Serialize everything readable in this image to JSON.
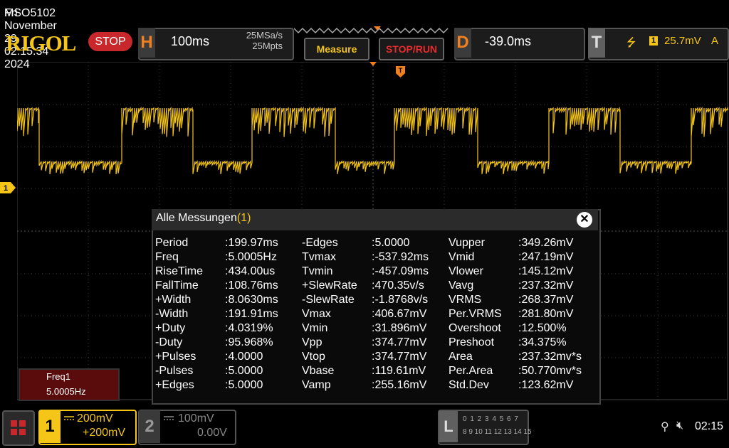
{
  "title_bar": {
    "model": "MSO5102",
    "datetime": "Fri November 29 02:15:34 2024"
  },
  "logo": "RIGOL",
  "status": "STOP",
  "horizontal": {
    "letter": "H",
    "timebase": "100ms",
    "sample_rate": "25MSa/s",
    "memory_depth": "25Mpts"
  },
  "buttons": {
    "measure": "Measure",
    "stop_run": "STOP/RUN"
  },
  "delay": {
    "letter": "D",
    "value": "-39.0ms"
  },
  "trigger": {
    "letter": "T",
    "slope": "⭍",
    "source": "1",
    "level": "25.7mV",
    "mode": "A"
  },
  "channel_marker": "1",
  "measurements": {
    "title": "Alle Messungen",
    "count": "(1)",
    "close": "✕",
    "columns": [
      {
        "rows": [
          {
            "name": "Period",
            "value": ":199.97ms"
          },
          {
            "name": "Freq",
            "value": ":5.0005Hz"
          },
          {
            "name": "RiseTime",
            "value": ":434.00us"
          },
          {
            "name": "FallTime",
            "value": ":108.76ms"
          },
          {
            "name": "+Width",
            "value": ":8.0630ms"
          },
          {
            "name": "-Width",
            "value": ":191.91ms"
          },
          {
            "name": "+Duty",
            "value": ":4.0319%"
          },
          {
            "name": "-Duty",
            "value": ":95.968%"
          },
          {
            "name": "+Pulses",
            "value": ":4.0000"
          },
          {
            "name": "-Pulses",
            "value": ":5.0000"
          },
          {
            "name": "+Edges",
            "value": ":5.0000"
          }
        ]
      },
      {
        "rows": [
          {
            "name": "-Edges",
            "value": ":5.0000"
          },
          {
            "name": "Tvmax",
            "value": ":-537.92ms"
          },
          {
            "name": "Tvmin",
            "value": ":-457.09ms"
          },
          {
            "name": "+SlewRate",
            "value": ":470.35v/s"
          },
          {
            "name": "-SlewRate",
            "value": ":-1.8768v/s"
          },
          {
            "name": "Vmax",
            "value": ":406.67mV"
          },
          {
            "name": "Vmin",
            "value": ":31.896mV"
          },
          {
            "name": "Vpp",
            "value": ":374.77mV"
          },
          {
            "name": "Vtop",
            "value": ":374.77mV"
          },
          {
            "name": "Vbase",
            "value": ":119.61mV"
          },
          {
            "name": "Vamp",
            "value": ":255.16mV"
          }
        ]
      },
      {
        "rows": [
          {
            "name": "Vupper",
            "value": ":349.26mV"
          },
          {
            "name": "Vmid",
            "value": ":247.19mV"
          },
          {
            "name": "Vlower",
            "value": ":145.12mV"
          },
          {
            "name": "Vavg",
            "value": ":237.32mV"
          },
          {
            "name": "VRMS",
            "value": ":268.37mV"
          },
          {
            "name": "Per.VRMS",
            "value": ":281.80mV"
          },
          {
            "name": "Overshoot",
            "value": ":12.500%"
          },
          {
            "name": "Preshoot",
            "value": ":34.375%"
          },
          {
            "name": "Area",
            "value": ":237.32mv*s"
          },
          {
            "name": "Per.Area",
            "value": ":50.770mv*s"
          },
          {
            "name": "Std.Dev",
            "value": ":123.62mV"
          }
        ]
      }
    ]
  },
  "freq_box": {
    "name": "Freq1",
    "value": "5.0005Hz"
  },
  "channel1": {
    "number": "1",
    "scale": "200mV",
    "offset": "+200mV"
  },
  "channel2": {
    "number": "2",
    "scale": "100mV",
    "offset": "0.00V"
  },
  "logic": {
    "letter": "L",
    "row1": "0 1 2 3  4 5 6 7",
    "row2": "8 9 10 11 12 13 14 15"
  },
  "clock": "02:15",
  "colors": {
    "ch1": "#f5c518",
    "stop": "#c8282c",
    "accent": "#f08020"
  }
}
